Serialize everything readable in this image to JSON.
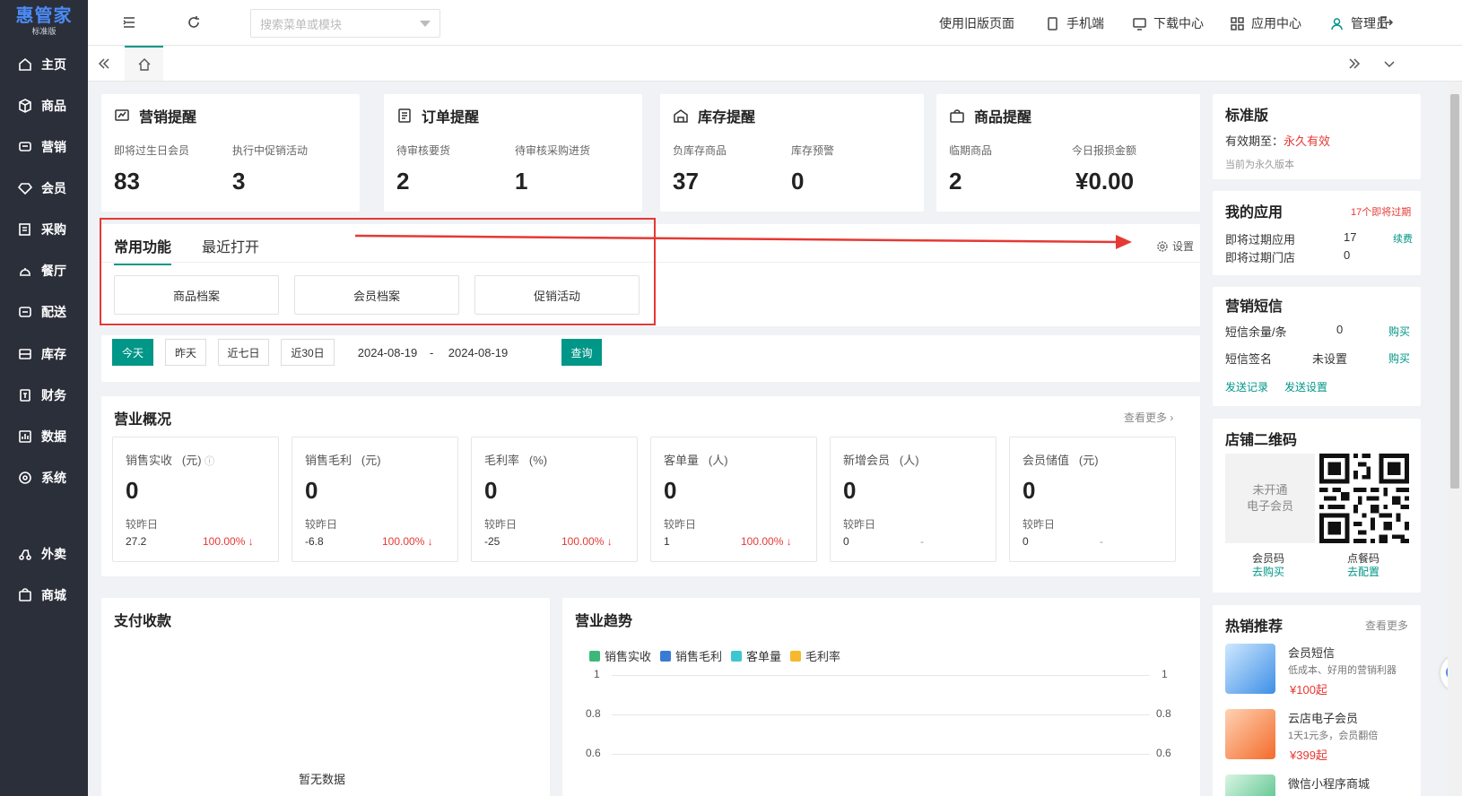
{
  "brand": {
    "name": "惠管家",
    "edition": "标准版"
  },
  "sidebar": {
    "items": [
      {
        "label": "主页",
        "icon": "home-icon"
      },
      {
        "label": "商品",
        "icon": "box-icon"
      },
      {
        "label": "营销",
        "icon": "chat-icon"
      },
      {
        "label": "会员",
        "icon": "diamond-icon"
      },
      {
        "label": "采购",
        "icon": "purchase-icon"
      },
      {
        "label": "餐厅",
        "icon": "dining-icon"
      },
      {
        "label": "配送",
        "icon": "delivery-icon"
      },
      {
        "label": "库存",
        "icon": "stock-icon"
      },
      {
        "label": "财务",
        "icon": "finance-icon"
      },
      {
        "label": "数据",
        "icon": "chart-icon"
      },
      {
        "label": "系统",
        "icon": "settings-icon"
      },
      {
        "label": "外卖",
        "icon": "takeout-icon"
      },
      {
        "label": "商城",
        "icon": "store-icon"
      }
    ]
  },
  "topbar": {
    "search_placeholder": "搜索菜单或模块",
    "old_version": "使用旧版页面",
    "mobile": "手机端",
    "download": "下载中心",
    "apps": "应用中心",
    "user": "管理员"
  },
  "reminders": [
    {
      "title": "营销提醒",
      "icon": "trend-icon",
      "items": [
        {
          "label": "即将过生日会员",
          "value": "83"
        },
        {
          "label": "执行中促销活动",
          "value": "3"
        }
      ]
    },
    {
      "title": "订单提醒",
      "icon": "document-icon",
      "items": [
        {
          "label": "待审核要货",
          "value": "2"
        },
        {
          "label": "待审核采购进货",
          "value": "1"
        }
      ]
    },
    {
      "title": "库存提醒",
      "icon": "warehouse-icon",
      "items": [
        {
          "label": "负库存商品",
          "value": "37"
        },
        {
          "label": "库存预警",
          "value": "0"
        }
      ]
    },
    {
      "title": "商品提醒",
      "icon": "bag-icon",
      "items": [
        {
          "label": "临期商品",
          "value": "2"
        },
        {
          "label": "今日报损金额",
          "value": "¥0.00"
        }
      ]
    }
  ],
  "functions": {
    "tabs": [
      "常用功能",
      "最近打开"
    ],
    "settings": "设置",
    "buttons": [
      "商品档案",
      "会员档案",
      "促销活动"
    ]
  },
  "filter": {
    "presets": [
      "今天",
      "昨天",
      "近七日",
      "近30日"
    ],
    "start_date": "2024-08-19",
    "separator": "-",
    "end_date": "2024-08-19",
    "query": "查询"
  },
  "overview": {
    "title": "营业概况",
    "more": "查看更多",
    "compare_label": "较昨日",
    "metrics": [
      {
        "name": "销售实收",
        "unit": "(元)",
        "value": "0",
        "prev": "27.2",
        "pct": "100.00%"
      },
      {
        "name": "销售毛利",
        "unit": "(元)",
        "value": "0",
        "prev": "-6.8",
        "pct": "100.00%"
      },
      {
        "name": "毛利率",
        "unit": "(%)",
        "value": "0",
        "prev": "-25",
        "pct": "100.00%"
      },
      {
        "name": "客单量",
        "unit": "(人)",
        "value": "0",
        "prev": "1",
        "pct": "100.00%"
      },
      {
        "name": "新增会员",
        "unit": "(人)",
        "value": "0",
        "prev": "0",
        "pct": "-"
      },
      {
        "name": "会员储值",
        "unit": "(元)",
        "value": "0",
        "prev": "0",
        "pct": "-"
      }
    ]
  },
  "payment": {
    "title": "支付收款",
    "empty": "暂无数据"
  },
  "trend": {
    "title": "营业趋势",
    "legend": [
      {
        "name": "销售实收",
        "color": "#3cb878"
      },
      {
        "name": "销售毛利",
        "color": "#3a7bd5"
      },
      {
        "name": "客单量",
        "color": "#3ec6d0"
      },
      {
        "name": "毛利率",
        "color": "#f5b82e"
      }
    ],
    "ticks_left": [
      "1",
      "0.8",
      "0.6"
    ],
    "ticks_right": [
      "1",
      "0.8",
      "0.6"
    ]
  },
  "standard": {
    "title": "标准版",
    "valid_label": "有效期至：",
    "valid_value": "永久有效",
    "note": "当前为永久版本"
  },
  "my_apps": {
    "title": "我的应用",
    "alert": "17个即将过期",
    "rows": [
      {
        "label": "即将过期应用",
        "value": "17",
        "action": "续费"
      },
      {
        "label": "即将过期门店",
        "value": "0",
        "action": ""
      }
    ]
  },
  "sms": {
    "title": "营销短信",
    "rows": [
      {
        "label": "短信余量/条",
        "value": "0",
        "action": "购买"
      },
      {
        "label": "短信签名",
        "value": "未设置",
        "action": "购买"
      }
    ],
    "links": [
      "发送记录",
      "发送设置"
    ]
  },
  "qrcode": {
    "title": "店铺二维码",
    "placeholder": "未开通\n电子会员",
    "member_label": "会员码",
    "member_action": "去购买",
    "order_label": "点餐码",
    "order_action": "去配置"
  },
  "hot": {
    "title": "热销推荐",
    "more": "查看更多",
    "items": [
      {
        "name": "会员短信",
        "desc": "低成本、好用的营销利器",
        "price": "¥100起"
      },
      {
        "name": "云店电子会员",
        "desc": "1天1元多，会员翻倍",
        "price": "¥399起"
      },
      {
        "name": "微信小程序商城",
        "desc": "",
        "price": ""
      }
    ]
  },
  "colors": {
    "accent": "#009688",
    "sidebar": "#2b2f3a",
    "alert": "#e53935",
    "brand": "#4b8bf5"
  }
}
